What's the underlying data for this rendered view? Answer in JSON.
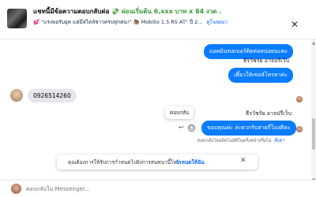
{
  "header": {
    "title_main": "แชทนี้มีข้อความตอบกลับต่อ",
    "title_emoji": "💸",
    "title_price": "ผ่อนเริ่มต้น 6,xxx บาท x 84 งวด .",
    "subtitle_heart": "💕",
    "subtitle_text": "\"แรงพอรับยุค แต่มีสไตล์ชาวครบทุกคน!\"",
    "subtitle_sep": "🦣",
    "subtitle_model": "Mobilio 1.5 RS AT\" ปี 2...",
    "subtitle_link": "ดูโฆษณา",
    "close_icon": "✕"
  },
  "messages": {
    "out_1": "แอดมินขอเบอร์ติดต่อหน่อยนะคะ",
    "sender_1": "ธีรวัชรัย อาจปรีเว็บ",
    "out_2": "เดี๋ยวให้เซลล์โทรหาค่ะ",
    "in_1": "0926514260",
    "sender_2": "ธีรวัชรัย อาจปรีเว็บ",
    "out_3": "ขอบคุณค่ะ สะดวกรับสายกี่โมงดีคะ"
  },
  "hover_actions": {
    "tooltip": "ตอบกลับ",
    "reply_icon": "↩",
    "emoji_icon": "☺"
  },
  "hint": {
    "text": "ตอบกลับโดยอัตโนมัติในครั้งหน้าหรือไม่",
    "link": "ตั้งค่า"
  },
  "notice": {
    "text": "คุณต้องการให้รับการกำหนดไปยังการสนทนานี้ไหม",
    "link": "กำหนดให้ฉัน",
    "close_icon": "✕"
  },
  "composer": {
    "placeholder": "ตอบกลับใน Messenger...",
    "value": ""
  },
  "scrollbar": {
    "up": "▲",
    "down": "▼"
  }
}
